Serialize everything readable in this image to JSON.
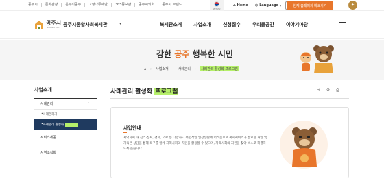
{
  "util": {
    "links": [
      "공주시",
      "문화관광",
      "온누리공주",
      "고향나루재단",
      "365종보관",
      "공주시의회",
      "공주시 브랜드"
    ],
    "flag_label": "국가상징",
    "home": "Home",
    "language": "Language",
    "font_size": "가",
    "cta": "현재 홈페이지 바로가기"
  },
  "header": {
    "logo_text": "공주시",
    "logo_sub": "GONGJU CITY",
    "org_name": "공주시종합사회복지관",
    "gnb": [
      "복지관소개",
      "사업소개",
      "신청접수",
      "우리들공간",
      "이야기마당"
    ]
  },
  "banner": {
    "slogan_part1": "강한 ",
    "slogan_accent": "공주",
    "slogan_part2": " 행복한 시민",
    "breadcrumb": [
      "사업소개",
      "사례관리",
      "사례관리 활성화 프로그램"
    ]
  },
  "sidebar": {
    "title": "사업소개",
    "item_case": "사례관리",
    "sub_case_mgmt": "사례관리기",
    "sub_activation": "사례관리 활성화",
    "sub_activation_hl": "프로그램",
    "item_service": "서비스제공",
    "item_community": "지역조직화"
  },
  "content": {
    "title_plain": "사례관리 활성화 ",
    "title_hl": "프로그램",
    "card_title": "사업안내",
    "card_body": "지역사회 내 심리·정서, 경제, 의료 등 다양하고 복합적인 일상생활에 어려움으로 복지서비스가 필요한 개인 및 가족은 상담을 통해 욕구를 알게 지역사회의 자원을 활용할 수 있으며, 지역사회의 자원을 찾아 스스로 해결하도록 돕습니다."
  },
  "colors": {
    "accent": "#e8762b",
    "nav_active": "#1f3a5f",
    "highlight": "#b6f06a"
  }
}
